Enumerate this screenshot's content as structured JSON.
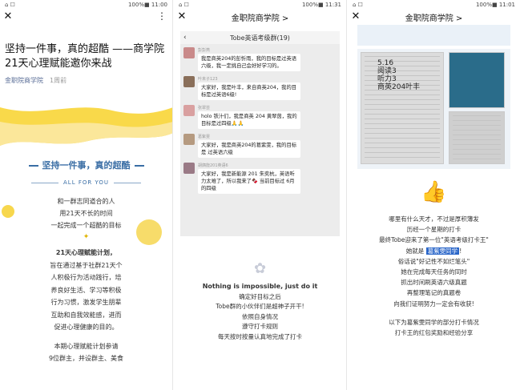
{
  "phones": [
    {
      "status": {
        "left": "⌂ ☐",
        "right": "100%■ 11:00"
      },
      "title": "",
      "article": {
        "title": "坚持一件事，真的超酷 ——商学院21天心理赋能邀你来战",
        "author": "金职院商学院",
        "time": "1周前"
      },
      "hero": {
        "heading": "坚持一件事，真的超酷",
        "subheading": "ALL FOR YOU"
      },
      "intro_lines": [
        "和一群志同道合的人",
        "用21天不长的时间",
        "一起完成一个超酷的目标"
      ],
      "plan_lines": [
        "21天心理赋能计划，",
        "旨在通过基于社群21天个",
        "人积极行为活动践行，培",
        "养良好生活、学习等积极",
        "行为习惯，激发学生朋辈",
        "互助和自我效能感，进而",
        "促进心理健康的目的。"
      ],
      "tail_lines": [
        "本期心理赋能计划参请",
        "9位群主，并设群主、美食"
      ]
    },
    {
      "status": {
        "left": "⌂ ☐",
        "right": "100%■ 11:31"
      },
      "title": "金职院商学院 >",
      "chat": {
        "group_name": "Tobe英语考级群(19)",
        "messages": [
          {
            "name": "彭彭燕",
            "text": "我是商英204的彭忻雨，我的目标是过英语六级，我一定挑自己会好好学习的。"
          },
          {
            "name": "叶未子123",
            "text": "大家好，我是叶丰，来自商英204，我的目标是过英语6级!"
          },
          {
            "name": "张翠芸",
            "text": "holo 铁汁们，我是商英 204 黄翠茵，我的目标是过四级🙏🙏"
          },
          {
            "name": "葛紫雯",
            "text": "大家好，我是商英204的葛紫雯，我的目标是 过英语六级"
          },
          {
            "name": "胡旖旎201英语6",
            "text": "大家好，我是新能源 201 朱奕杭，英语听力太难了，所以我来了🍫 当前目标过 6月的四级"
          }
        ]
      },
      "lines": [
        "Nothing is impossible, just do it",
        "确定好目标之后",
        "Tobe群的小伙伴们是超神子开干!",
        "依照自身情况",
        "遵守打卡规则",
        "每天按时按量认真地完成了打卡"
      ]
    },
    {
      "status": {
        "left": "⌂ ☐",
        "right": "100%■ 11:01"
      },
      "title": "金职院商学院 >",
      "photo_caption": [
        "5.16",
        "阅读3",
        "听力3",
        "商英204叶丰"
      ],
      "lines_before": [
        "哪里有什么天才，不过是厚积薄发",
        "历经一个星期的打卡",
        "最终Tobe迎来了第一位\"英语考级打卡王\""
      ],
      "highlight_prefix": "她就是",
      "highlight_name": "葛紫雯同学",
      "highlight_suffix": "!",
      "lines_after": [
        "俗话说\"好记性不如烂笔头\"",
        "她在完成每天任务的同时",
        "抓出时间刷英语六级真题",
        "再整理笔记的真题卷",
        "向我们证明努力一定会有收获!",
        "",
        "以下为葛紫雯同学的部分打卡情况",
        "打卡王的红包奖励和经验分享"
      ]
    }
  ],
  "colors": {
    "accent_blue": "#3a6ea5",
    "yellow": "#f9d94a",
    "chat_bg": "#ececec",
    "highlight": "#2a66c9"
  },
  "icons": [
    "close-icon",
    "more-icon",
    "back-icon",
    "flower-icon",
    "thumbs-up-icon"
  ]
}
